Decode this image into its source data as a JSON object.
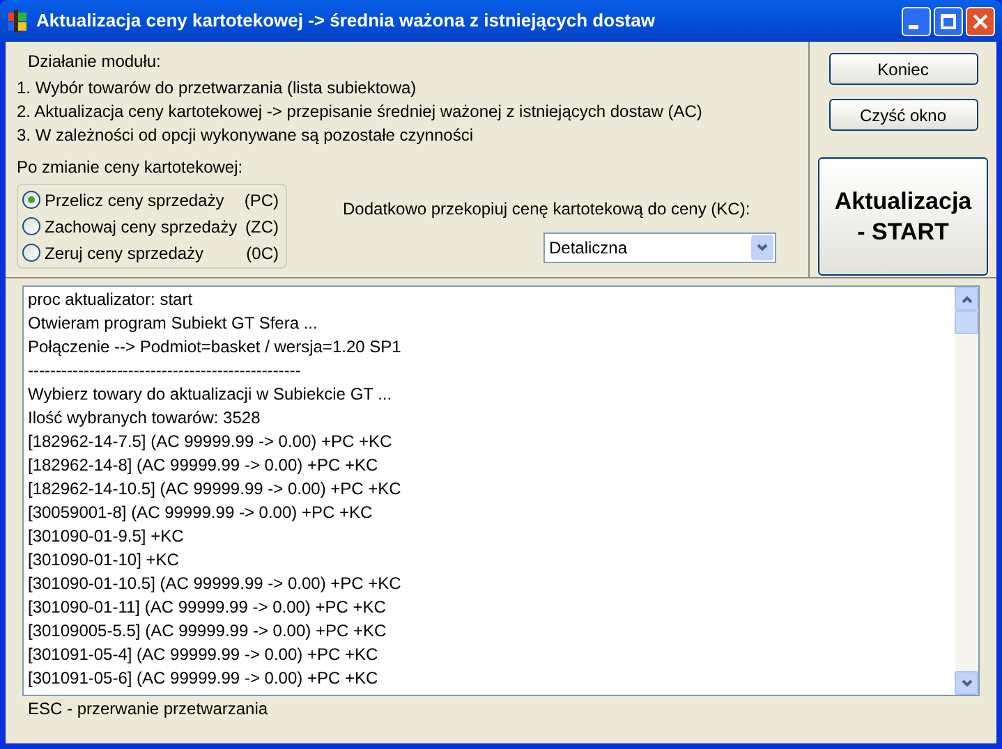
{
  "window": {
    "title": "Aktualizacja ceny kartotekowej -> średnia ważona z istniejących dostaw"
  },
  "description": {
    "heading": "Działanie modułu:",
    "steps": [
      "1. Wybór towarów do przetwarzania (lista subiektowa)",
      "2. Aktualizacja ceny kartotekowej -> przepisanie średniej ważonej z istniejących dostaw (AC)",
      "3. W zależności od opcji wykonywane są pozostałe czynności"
    ]
  },
  "options": {
    "label": "Po zmianie ceny kartotekowej:",
    "radios": [
      {
        "label": "Przelicz ceny sprzedaży",
        "code": "(PC)",
        "selected": true
      },
      {
        "label": "Zachowaj ceny sprzedaży",
        "code": "(ZC)",
        "selected": false
      },
      {
        "label": "Zeruj ceny sprzedaży",
        "code": "(0C)",
        "selected": false
      }
    ]
  },
  "copy": {
    "label": "Dodatkowo przekopiuj cenę kartotekową do ceny (KC):",
    "select": {
      "value": "Detaliczna"
    }
  },
  "buttons": [
    {
      "label": "Koniec",
      "kind": "small"
    },
    {
      "label": "Czyść okno",
      "kind": "small"
    },
    {
      "label": "Aktualizacja - START",
      "kind": "large"
    }
  ],
  "log": {
    "lines": [
      "proc aktualizator: start",
      "Otwieram program Subiekt GT Sfera ...",
      "Połączenie --> Podmiot=basket / wersja=1.20 SP1",
      "-------------------------------------------------",
      "Wybierz towary do aktualizacji w Subiekcie GT ...",
      "Ilość wybranych towarów: 3528",
      "[182962-14-7.5] (AC 99999.99 -> 0.00) +PC +KC",
      "[182962-14-8] (AC 99999.99 -> 0.00) +PC +KC",
      "[182962-14-10.5] (AC 99999.99 -> 0.00) +PC +KC",
      "[30059001-8] (AC 99999.99 -> 0.00) +PC +KC",
      "[301090-01-9.5] +KC",
      "[301090-01-10] +KC",
      "[301090-01-10.5] (AC 99999.99 -> 0.00) +PC +KC",
      "[301090-01-11] (AC 99999.99 -> 0.00) +PC +KC",
      "[30109005-5.5] (AC 99999.99 -> 0.00) +PC +KC",
      "[301091-05-4] (AC 99999.99 -> 0.00) +PC +KC",
      "[301091-05-6] (AC 99999.99 -> 0.00) +PC +KC"
    ]
  },
  "status_bar": {
    "text": "ESC - przerwanie przetwarzania"
  }
}
